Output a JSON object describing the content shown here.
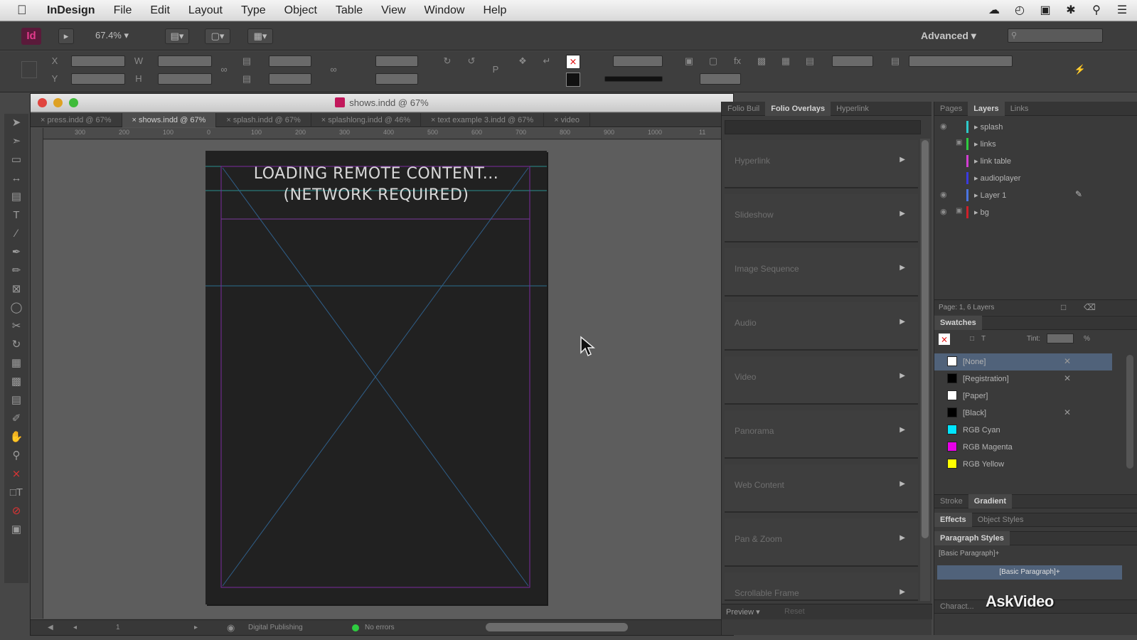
{
  "menubar": {
    "app": "InDesign",
    "items": [
      "File",
      "Edit",
      "Layout",
      "Type",
      "Object",
      "Table",
      "View",
      "Window",
      "Help"
    ]
  },
  "appbar": {
    "logo": "Id",
    "zoom": "67.4%",
    "workspace": "Advanced"
  },
  "document": {
    "title": "shows.indd @ 67%",
    "tabs": [
      {
        "label": "press.indd @ 67%",
        "active": false
      },
      {
        "label": "shows.indd @ 67%",
        "active": true
      },
      {
        "label": "splash.indd @ 67%",
        "active": false
      },
      {
        "label": "splashlong.indd @ 46%",
        "active": false
      },
      {
        "label": "text example 3.indd @ 67%",
        "active": false
      },
      {
        "label": "video",
        "active": false
      }
    ],
    "ruler_labels": [
      "300",
      "200",
      "100",
      "0",
      "100",
      "200",
      "300",
      "400",
      "500",
      "600",
      "700",
      "800",
      "900",
      "1000",
      "11"
    ],
    "page_text_line1": "LOADING REMOTE CONTENT...",
    "page_text_line2": "(NETWORK REQUIRED)",
    "status": {
      "page": "1",
      "profile": "Digital Publishing",
      "errors": "No errors"
    }
  },
  "folio_panel": {
    "tabs": [
      {
        "label": "Folio Buil",
        "active": false
      },
      {
        "label": "Folio Overlays",
        "active": true
      },
      {
        "label": "Hyperlink",
        "active": false
      }
    ],
    "overlays": [
      "Hyperlink",
      "Slideshow",
      "Image Sequence",
      "Audio",
      "Video",
      "Panorama",
      "Web Content",
      "Pan & Zoom",
      "Scrollable Frame"
    ],
    "footer_preview": "Preview",
    "footer_reset": "Reset"
  },
  "layers_panel": {
    "tabs": [
      {
        "label": "Pages",
        "active": false
      },
      {
        "label": "Layers",
        "active": true
      },
      {
        "label": "Links",
        "active": false
      }
    ],
    "layers": [
      {
        "name": "splash",
        "color": "#2ec9c9"
      },
      {
        "name": "links",
        "color": "#2ecc40"
      },
      {
        "name": "link table",
        "color": "#d23ed2"
      },
      {
        "name": "audioplayer",
        "color": "#3a3ae0"
      },
      {
        "name": "Layer 1",
        "color": "#4a74e0"
      },
      {
        "name": "bg",
        "color": "#d0202a"
      }
    ],
    "footer": "Page: 1, 6 Layers"
  },
  "swatches_panel": {
    "tab": "Swatches",
    "tint_label": "Tint:",
    "tint_unit": "%",
    "items": [
      {
        "name": "[None]",
        "color": "#ffffff",
        "selected": true
      },
      {
        "name": "[Registration]",
        "color": "#000000",
        "selected": false
      },
      {
        "name": "[Paper]",
        "color": "#ffffff",
        "selected": false
      },
      {
        "name": "[Black]",
        "color": "#000000",
        "selected": false
      },
      {
        "name": "RGB Cyan",
        "color": "#00e5ff",
        "selected": false
      },
      {
        "name": "RGB Magenta",
        "color": "#e800e8",
        "selected": false
      },
      {
        "name": "RGB Yellow",
        "color": "#ffff00",
        "selected": false
      }
    ]
  },
  "lower_panels": {
    "stroke_tab": "Stroke",
    "gradient_tab": "Gradient",
    "effects_tab": "Effects",
    "object_styles_tab": "Object Styles",
    "paragraph_styles_tab": "Paragraph Styles",
    "paragraph_basic_header": "[Basic Paragraph]+",
    "paragraph_basic_item": "[Basic Paragraph]+",
    "character_styles_tab": "Charact..."
  },
  "watermark": "AskVideo"
}
